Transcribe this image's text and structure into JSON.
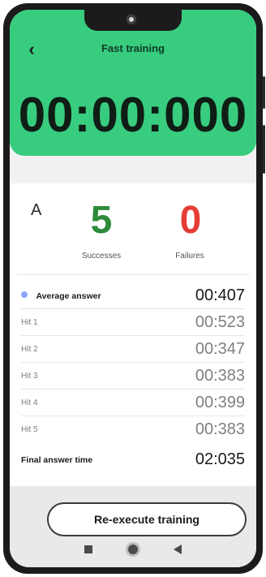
{
  "app": {
    "title": "Fast training",
    "timer": "00:00:000"
  },
  "summary": {
    "letter": "A",
    "successes": {
      "value": "5",
      "label": "Successes"
    },
    "failures": {
      "value": "0",
      "label": "Failures"
    }
  },
  "stats": {
    "average": {
      "label": "Average answer",
      "value": "00:407"
    },
    "hits": [
      {
        "label": "Hit 1",
        "value": "00:523"
      },
      {
        "label": "Hit 2",
        "value": "00:347"
      },
      {
        "label": "Hit 3",
        "value": "00:383"
      },
      {
        "label": "Hit 4",
        "value": "00:399"
      },
      {
        "label": "Hit 5",
        "value": "00:383"
      }
    ],
    "final": {
      "label": "Final answer time",
      "value": "02:035"
    }
  },
  "actions": {
    "reexecute_label": "Re-execute training"
  },
  "colors": {
    "header": "#38cc7f",
    "success": "#2e8b3a",
    "failure": "#e53d35"
  }
}
